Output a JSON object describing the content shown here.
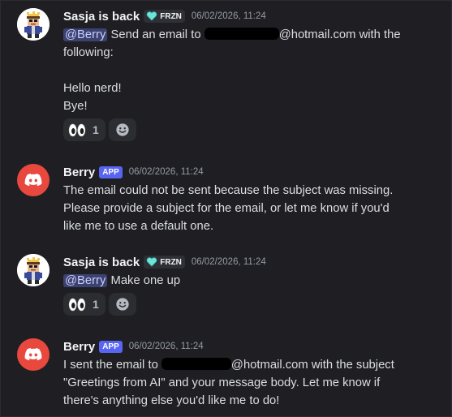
{
  "messages": [
    {
      "author": "Sasja is back",
      "author_type": "user",
      "guild_tag": "FRZN",
      "timestamp": "06/02/2026, 11:24",
      "mention": "@Berry",
      "text_before": "Send an email to",
      "email_domain": "@hotmail.com with the",
      "line2": "following:",
      "line3": "Hello nerd!",
      "line4": "Bye!",
      "reaction": {
        "emoji": "eyes",
        "count": "1"
      }
    },
    {
      "author": "Berry",
      "author_type": "bot",
      "badge": "APP",
      "timestamp": "06/02/2026, 11:24",
      "line1": "The email could not be sent because the subject was missing.",
      "line2": "Please provide a subject for the email, or let me know if you'd",
      "line3": "like me to use a default one."
    },
    {
      "author": "Sasja is back",
      "author_type": "user",
      "guild_tag": "FRZN",
      "timestamp": "06/02/2026, 11:24",
      "mention": "@Berry",
      "text_after": "Make one up",
      "reaction": {
        "emoji": "eyes",
        "count": "1"
      }
    },
    {
      "author": "Berry",
      "author_type": "bot",
      "badge": "APP",
      "timestamp": "06/02/2026, 11:24",
      "text_before": "I sent the email to",
      "email_domain": "@hotmail.com with the subject",
      "line2": "\"Greetings from AI\" and your message body. Let me know if",
      "line3": "there's anything else you'd like me to do!"
    }
  ],
  "colors": {
    "background": "#1f1f23",
    "mention_bg": "#3c4270",
    "app_badge": "#5865f2",
    "bot_avatar": "#e8483e"
  },
  "icons": [
    "user-avatar-icon",
    "discord-logo-icon",
    "heart-icon",
    "eyes-emoji-icon",
    "add-reaction-icon"
  ]
}
